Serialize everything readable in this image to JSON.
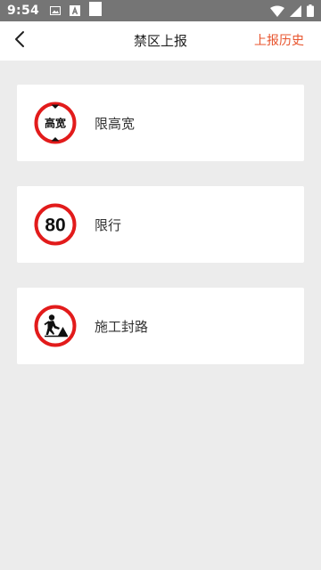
{
  "status_bar": {
    "time": "9:54",
    "icons": [
      "image-notification-icon",
      "font-notification-icon",
      "blank-notification-icon",
      "wifi-icon",
      "signal-icon",
      "battery-icon"
    ]
  },
  "header": {
    "back_icon": "chevron-left-icon",
    "title": "禁区上报",
    "history_label": "上报历史"
  },
  "colors": {
    "accent": "#e8542d",
    "sign_red": "#e21b1b",
    "page_bg": "#ececec",
    "status_bg": "#757575"
  },
  "items": [
    {
      "label": "限高宽",
      "icon": "height-width-limit-sign-icon",
      "sign_text": "高宽"
    },
    {
      "label": "限行",
      "icon": "speed-limit-sign-icon",
      "sign_text": "80"
    },
    {
      "label": "施工封路",
      "icon": "road-work-sign-icon"
    }
  ]
}
